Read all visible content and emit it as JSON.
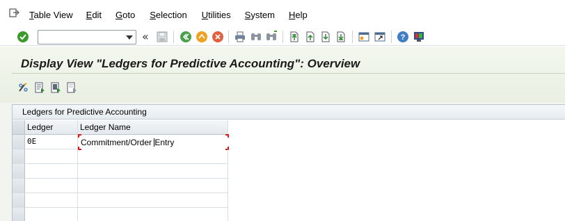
{
  "menubar": {
    "items": [
      "Table View",
      "Edit",
      "Goto",
      "Selection",
      "Utilities",
      "System",
      "Help"
    ]
  },
  "toolbar": {
    "command_field_value": ""
  },
  "header": {
    "title": "Display View \"Ledgers for Predictive Accounting\": Overview"
  },
  "section": {
    "title": "Ledgers for Predictive Accounting",
    "columns": [
      "Ledger",
      "Ledger Name"
    ],
    "rows": [
      {
        "ledger": "0E",
        "name_before_cursor": "Commitment/Order ",
        "name_after_cursor": "Entry"
      },
      {
        "ledger": "",
        "name_before_cursor": "",
        "name_after_cursor": ""
      },
      {
        "ledger": "",
        "name_before_cursor": "",
        "name_after_cursor": ""
      },
      {
        "ledger": "",
        "name_before_cursor": "",
        "name_after_cursor": ""
      },
      {
        "ledger": "",
        "name_before_cursor": "",
        "name_after_cursor": ""
      },
      {
        "ledger": "",
        "name_before_cursor": "",
        "name_after_cursor": ""
      }
    ]
  },
  "colors": {
    "title_bg": "#eef3e8",
    "selection_marker": "#d41a1a",
    "enter_green": "#3a9a2a"
  },
  "icons": {
    "menu": "menu-icon",
    "enter": "enter-check-icon",
    "save": "save-icon",
    "back": "back-icon",
    "exit": "exit-icon",
    "cancel": "cancel-icon",
    "print": "print-icon",
    "find": "find-icon",
    "find_next": "find-next-icon",
    "first_page": "first-page-icon",
    "prev_page": "previous-page-icon",
    "next_page": "next-page-icon",
    "last_page": "last-page-icon",
    "create_session": "create-session-icon",
    "shortcut": "shortcut-icon",
    "help": "help-icon",
    "layout": "customize-layout-icon"
  }
}
